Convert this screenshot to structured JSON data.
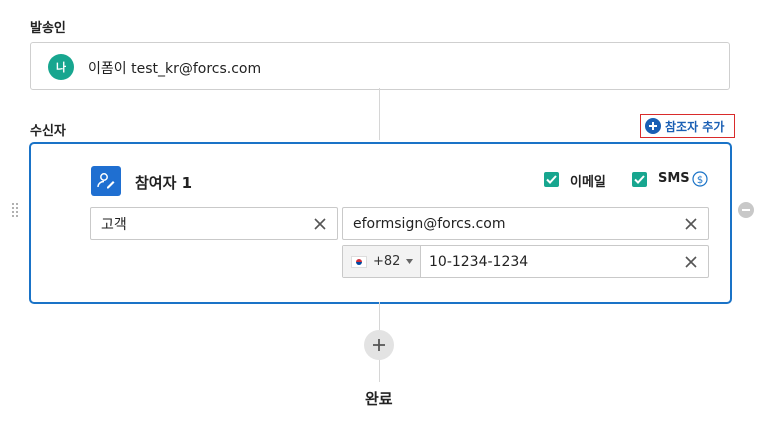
{
  "sender": {
    "section_label": "발송인",
    "avatar_initial": "나",
    "name_email": "이폼이 test_kr@forcs.com"
  },
  "recipients": {
    "section_label": "수신자",
    "add_cc_label": "참조자 추가",
    "participant": {
      "order": "2",
      "title": "참여자 1",
      "email_option": {
        "label": "이메일",
        "checked": true
      },
      "sms_option": {
        "label": "SMS",
        "checked": true
      },
      "name_value": "고객",
      "email_value": "eformsign@forcs.com",
      "country_code": "+82",
      "phone_value": "10-1234-1234"
    }
  },
  "flow": {
    "done_label": "완료"
  },
  "colors": {
    "accent": "#1a73c7",
    "check": "#17a68f",
    "highlight_border": "#d92b2b"
  }
}
